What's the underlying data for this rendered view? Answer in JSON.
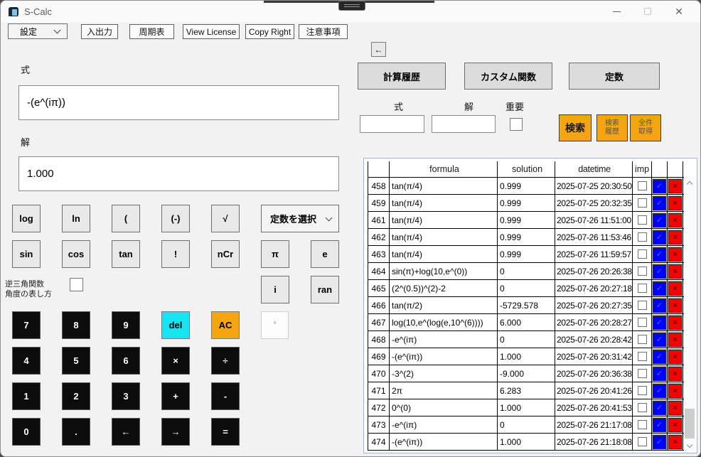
{
  "window": {
    "title": "S-Calc"
  },
  "menubar": {
    "settings_label": "設定",
    "buttons": [
      {
        "label": "入出力"
      },
      {
        "label": "周期表"
      },
      {
        "label": "View License"
      },
      {
        "label": "Copy Right"
      },
      {
        "label": "注意事項"
      }
    ]
  },
  "left": {
    "formula_label": "式",
    "formula_value": "-(e^(iπ))",
    "solution_label": "解",
    "solution_value": "1.000",
    "constants_select_label": "定数を選択",
    "func_row1": [
      "log",
      "ln",
      "(",
      "(-)",
      "√"
    ],
    "func_row2": [
      "sin",
      "cos",
      "tan",
      "!",
      "nCr"
    ],
    "pi": "π",
    "e": "e",
    "i": "i",
    "ran": "ran",
    "inverse_label_line1": "逆三角関数",
    "inverse_label_line2": "角度の表し方",
    "degree_label": "°",
    "numpad": [
      [
        "7",
        "8",
        "9",
        "del",
        "AC"
      ],
      [
        "4",
        "5",
        "6",
        "×",
        "÷"
      ],
      [
        "1",
        "2",
        "3",
        "+",
        "-"
      ],
      [
        "0",
        ".",
        "←",
        "→",
        "="
      ]
    ]
  },
  "right": {
    "back_label": "←",
    "nav": [
      {
        "label": "計算履歴"
      },
      {
        "label": "カスタム関数"
      },
      {
        "label": "定数"
      }
    ],
    "search": {
      "formula_label": "式",
      "solution_label": "解",
      "important_label": "重要",
      "search_button": "検索",
      "history_button_line1": "検索",
      "history_button_line2": "履歴",
      "getall_button_line1": "全件",
      "getall_button_line2": "取得"
    }
  },
  "table": {
    "headers": {
      "formula": "formula",
      "solution": "solution",
      "datetime": "datetime",
      "imp": "imp"
    },
    "check_glyph": "✓",
    "cross_glyph": "×",
    "rows": [
      {
        "num": "458",
        "formula": "tan(π/4)",
        "solution": "0.999",
        "datetime": "2025-07-25 20:30:50"
      },
      {
        "num": "459",
        "formula": "tan(π/4)",
        "solution": "0.999",
        "datetime": "2025-07-25 20:32:35"
      },
      {
        "num": "461",
        "formula": "tan(π/4)",
        "solution": "0.999",
        "datetime": "2025-07-26 11:51:00"
      },
      {
        "num": "462",
        "formula": "tan(π/4)",
        "solution": "0.999",
        "datetime": "2025-07-26 11:53:46"
      },
      {
        "num": "463",
        "formula": "tan(π/4)",
        "solution": "0.999",
        "datetime": "2025-07-26 11:59:57"
      },
      {
        "num": "464",
        "formula": "sin(π)+log(10,e^(0))",
        "solution": "0",
        "datetime": "2025-07-26 20:26:38"
      },
      {
        "num": "465",
        "formula": "(2^(0.5))^(2)-2",
        "solution": "0",
        "datetime": "2025-07-26 20:27:18"
      },
      {
        "num": "466",
        "formula": "tan(π/2)",
        "solution": "-5729.578",
        "datetime": "2025-07-26 20:27:35"
      },
      {
        "num": "467",
        "formula": "log(10,e^(log(e,10^(6))))",
        "solution": "6.000",
        "datetime": "2025-07-26 20:28:27"
      },
      {
        "num": "468",
        "formula": "-e^(iπ)",
        "solution": "0",
        "datetime": "2025-07-26 20:28:42"
      },
      {
        "num": "469",
        "formula": "-(e^(iπ))",
        "solution": "1.000",
        "datetime": "2025-07-26 20:31:42"
      },
      {
        "num": "470",
        "formula": "-3^(2)",
        "solution": "-9.000",
        "datetime": "2025-07-26 20:36:38"
      },
      {
        "num": "471",
        "formula": "2π",
        "solution": "6.283",
        "datetime": "2025-07-26 20:41:26"
      },
      {
        "num": "472",
        "formula": "0^(0)",
        "solution": "1.000",
        "datetime": "2025-07-26 20:41:53"
      },
      {
        "num": "473",
        "formula": "-e^(iπ)",
        "solution": "0",
        "datetime": "2025-07-26 21:17:08"
      },
      {
        "num": "474",
        "formula": "-(e^(iπ))",
        "solution": "1.000",
        "datetime": "2025-07-26 21:18:08"
      }
    ]
  },
  "colors": {
    "key_black": "#0c0c0c",
    "del_cyan": "#17e4f0",
    "accent_orange": "#f5a50f",
    "check_blue": "#0000fe",
    "delete_red": "#fb0000",
    "table_border_blue": "#9fb8da"
  }
}
